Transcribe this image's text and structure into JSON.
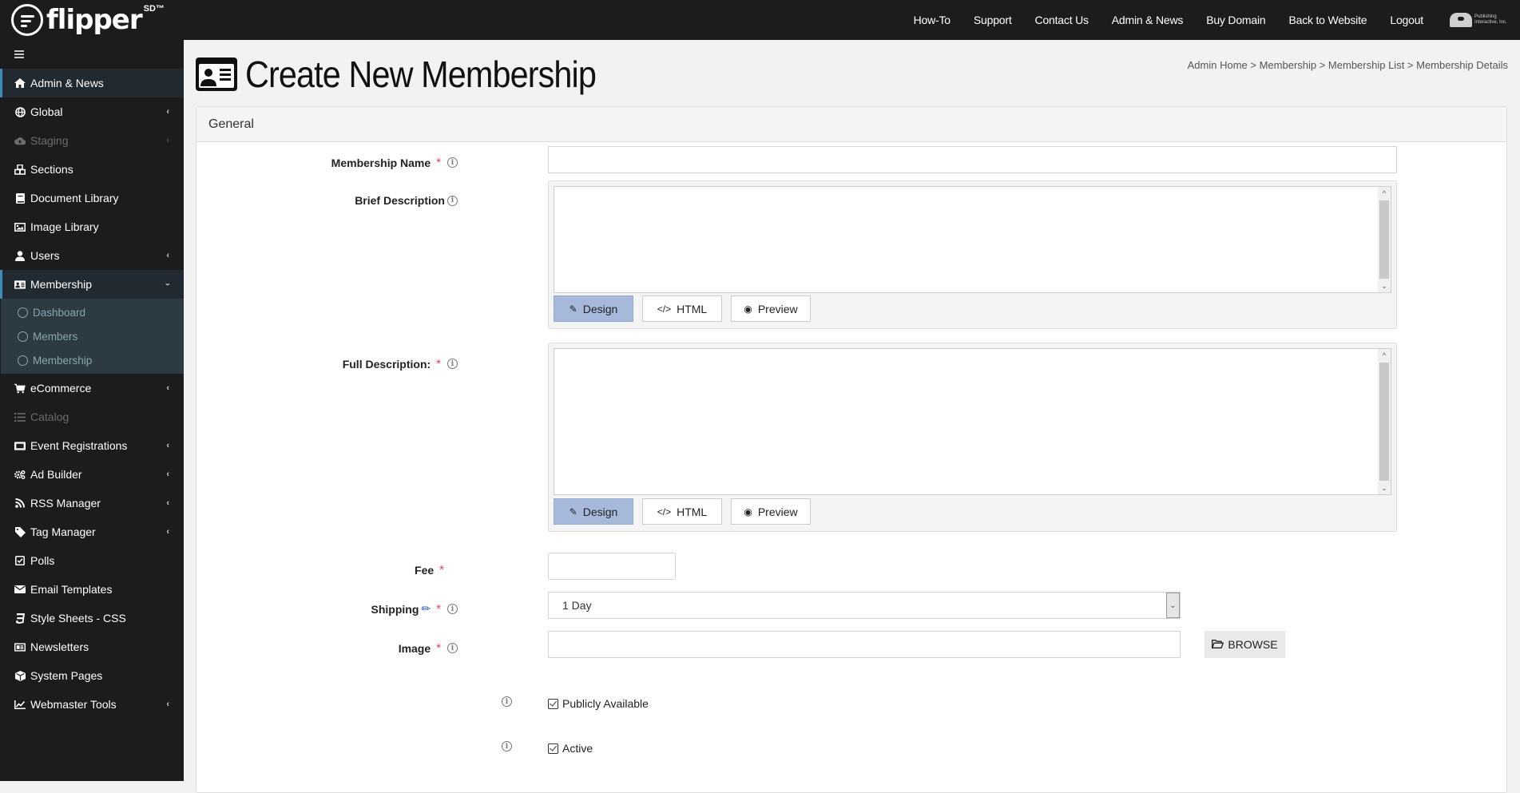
{
  "app": {
    "logo_text": "flipper",
    "logo_sup": "SD™",
    "partner_logo_line1": "Publishing",
    "partner_logo_line2": "Interactive, Inc."
  },
  "topnav": {
    "links": [
      "How-To",
      "Support",
      "Contact Us",
      "Admin & News",
      "Buy Domain",
      "Back to Website",
      "Logout"
    ]
  },
  "sidebar": {
    "items": [
      {
        "label": "Admin & News",
        "icon": "home-icon",
        "active": true
      },
      {
        "label": "Global",
        "icon": "globe-icon",
        "chevron": "left"
      },
      {
        "label": "Staging",
        "icon": "cloud-upload-icon",
        "chevron": "left",
        "disabled": true
      },
      {
        "label": "Sections",
        "icon": "cubes-icon"
      },
      {
        "label": "Document Library",
        "icon": "book-icon"
      },
      {
        "label": "Image Library",
        "icon": "image-icon"
      },
      {
        "label": "Users",
        "icon": "user-icon",
        "chevron": "left"
      },
      {
        "label": "Membership",
        "icon": "id-card-icon",
        "chevron": "down",
        "active": true
      },
      {
        "label": "eCommerce",
        "icon": "cart-icon",
        "chevron": "left"
      },
      {
        "label": "Catalog",
        "icon": "list-icon",
        "disabled": true
      },
      {
        "label": "Event Registrations",
        "icon": "ticket-icon",
        "chevron": "left"
      },
      {
        "label": "Ad Builder",
        "icon": "cogs-icon",
        "chevron": "left"
      },
      {
        "label": "RSS Manager",
        "icon": "rss-icon",
        "chevron": "left"
      },
      {
        "label": "Tag Manager",
        "icon": "tag-icon",
        "chevron": "left"
      },
      {
        "label": "Polls",
        "icon": "check-square-icon"
      },
      {
        "label": "Email Templates",
        "icon": "envelope-icon"
      },
      {
        "label": "Style Sheets - CSS",
        "icon": "css3-icon"
      },
      {
        "label": "Newsletters",
        "icon": "newspaper-icon"
      },
      {
        "label": "System Pages",
        "icon": "cube-icon"
      },
      {
        "label": "Webmaster Tools",
        "icon": "chart-line-icon",
        "chevron": "left"
      }
    ],
    "membership_submenu": [
      "Dashboard",
      "Members",
      "Membership"
    ]
  },
  "page": {
    "title": "Create New Membership",
    "breadcrumb": "Admin Home > Membership > Membership List > Membership Details"
  },
  "form": {
    "section_title": "General",
    "membership_name": {
      "label": "Membership Name",
      "value": "",
      "required": true
    },
    "brief_description": {
      "label": "Brief Description",
      "value": "",
      "required": false
    },
    "full_description": {
      "label": "Full Description:",
      "value": "",
      "required": true
    },
    "editor_buttons": {
      "design": "Design",
      "html": "HTML",
      "preview": "Preview",
      "active": "Design"
    },
    "fee": {
      "label": "Fee",
      "value": "",
      "required": true
    },
    "shipping": {
      "label": "Shipping",
      "value": "1 Day",
      "required": true
    },
    "image": {
      "label": "Image",
      "value": "",
      "required": true,
      "browse_label": "BROWSE"
    },
    "publicly_available": {
      "label": "Publicly Available",
      "checked": true
    },
    "active": {
      "label": "Active",
      "checked": true
    },
    "required_marker": "*",
    "info_glyph": "i"
  }
}
